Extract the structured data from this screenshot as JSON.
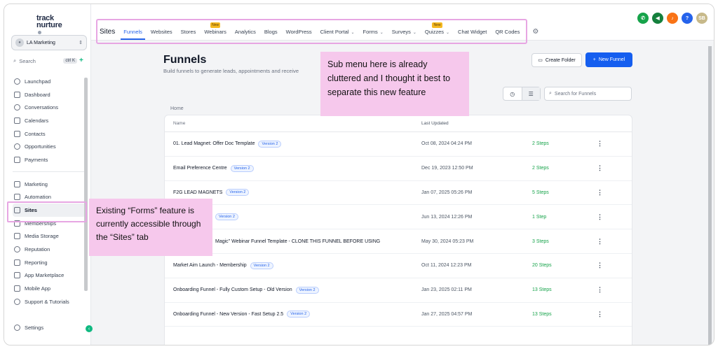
{
  "logo": {
    "line1": "track",
    "line2": "nurture"
  },
  "account": {
    "name": "LA Marketing"
  },
  "search": {
    "label": "Search",
    "shortcut": "ctrl K"
  },
  "sidebar": {
    "items": [
      {
        "label": "Launchpad"
      },
      {
        "label": "Dashboard"
      },
      {
        "label": "Conversations"
      },
      {
        "label": "Calendars"
      },
      {
        "label": "Contacts"
      },
      {
        "label": "Opportunities"
      },
      {
        "label": "Payments"
      }
    ],
    "items2": [
      {
        "label": "Marketing"
      },
      {
        "label": "Automation"
      },
      {
        "label": "Sites"
      },
      {
        "label": "Memberships"
      },
      {
        "label": "Media Storage"
      },
      {
        "label": "Reputation"
      },
      {
        "label": "Reporting"
      },
      {
        "label": "App Marketplace"
      },
      {
        "label": "Mobile App"
      },
      {
        "label": "Support & Tutorials"
      }
    ],
    "settings": "Settings"
  },
  "topbar": {
    "section": "Sites",
    "tabs": [
      {
        "label": "Funnels"
      },
      {
        "label": "Websites"
      },
      {
        "label": "Stores"
      },
      {
        "label": "Webinars",
        "badge": "New"
      },
      {
        "label": "Analytics"
      },
      {
        "label": "Blogs"
      },
      {
        "label": "WordPress"
      },
      {
        "label": "Client Portal"
      },
      {
        "label": "Forms"
      },
      {
        "label": "Surveys"
      },
      {
        "label": "Quizzes",
        "badge": "New"
      },
      {
        "label": "Chat Widget"
      },
      {
        "label": "QR Codes"
      }
    ],
    "avatar": "SB",
    "colors": [
      "#16a34a",
      "#15803d",
      "#f97316",
      "#2563eb",
      "#c7b98a"
    ]
  },
  "page": {
    "title": "Funnels",
    "subtitle": "Build funnels to generate leads, appointments and receive",
    "create_folder": "Create Folder",
    "new_funnel": "New Funnel",
    "search_placeholder": "Search for Funnels",
    "breadcrumb": "Home"
  },
  "table": {
    "headers": {
      "name": "Name",
      "updated": "Last Updated"
    },
    "rows": [
      {
        "name": "01. Lead Magnet: Offer Doc Template",
        "badge": "Version 2",
        "date": "Oct 08, 2024 04:24 PM",
        "steps": "2 Steps"
      },
      {
        "name": "Email Preference Centre",
        "badge": "Version 2",
        "date": "Dec 19, 2023 12:50 PM",
        "steps": "2 Steps"
      },
      {
        "name": "F2G LEAD MAGNETS",
        "badge": "Version 2",
        "date": "Jan 07, 2025 05:26 PM",
        "steps": "5 Steps"
      },
      {
        "name": "",
        "badge": "Version 2",
        "date": "Jun 13, 2024 12:26 PM",
        "steps": "1 Step"
      },
      {
        "name": "Magic\" Webinar Funnel Template - CLONE THIS FUNNEL BEFORE USING",
        "badge": "",
        "date": "May 30, 2024 05:23 PM",
        "steps": "3 Steps"
      },
      {
        "name": "Market Aim Launch - Membership",
        "badge": "Version 2",
        "date": "Oct 11, 2024 12:23 PM",
        "steps": "20 Steps"
      },
      {
        "name": "Onboarding Funnel - Fully Custom Setup - Old Version",
        "badge": "Version 2",
        "date": "Jan 23, 2025 02:11 PM",
        "steps": "13 Steps"
      },
      {
        "name": "Onboarding Funnel - New Version - Fast Setup 2.5",
        "badge": "Version 2",
        "date": "Jan 27, 2025 04:57 PM",
        "steps": "13 Steps"
      }
    ]
  },
  "annotations": {
    "submenu_note": "Sub menu here is already cluttered and I thought it best to separate this new feature",
    "sites_note": "Existing “Forms” feature is currently accessible through the “Sites” tab"
  }
}
